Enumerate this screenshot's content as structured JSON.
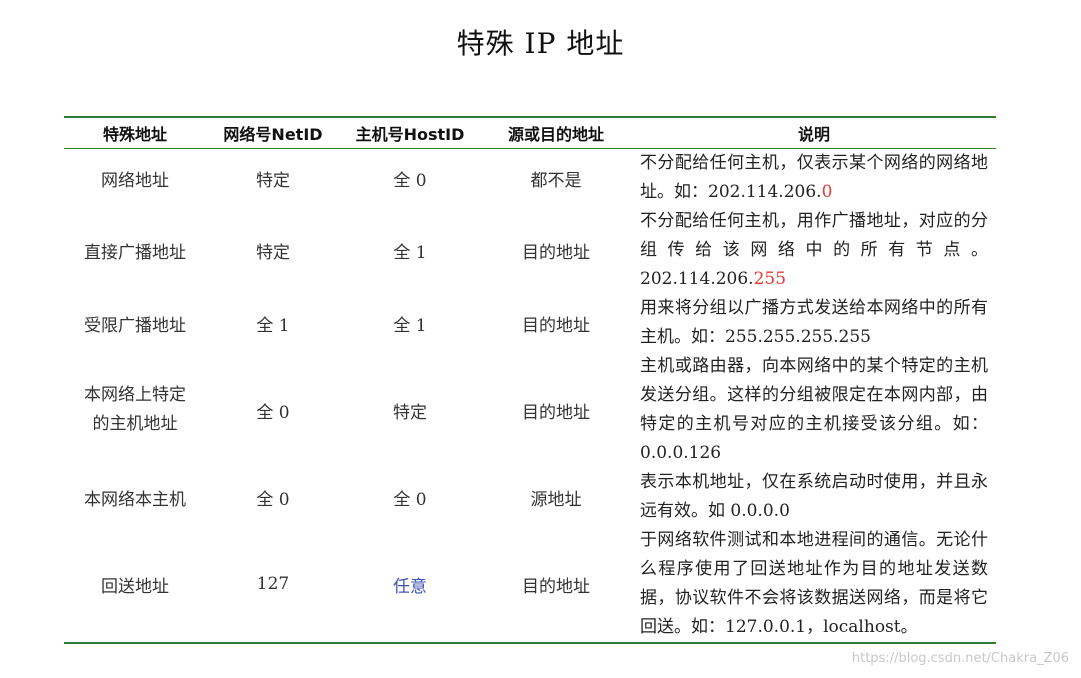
{
  "title": "特殊 IP 地址",
  "headers": [
    "特殊地址",
    "网络号NetID",
    "主机号HostID",
    "源或目的地址",
    "说明"
  ],
  "rows": [
    {
      "name": "网络地址",
      "netid": "特定",
      "hostid": "全 0",
      "srcdst": "都不是",
      "desc_main": "不分配给任何主机，仅表示某个网络的网络地址。如：202.114.206.",
      "desc_highlight": "0",
      "desc_tail": ""
    },
    {
      "name": "直接广播地址",
      "netid": "特定",
      "hostid": "全 1",
      "srcdst": "目的地址",
      "desc_main": "不分配给任何主机，用作广播地址，对应的分组传给该网络中的所有节点。202.114.206.",
      "desc_highlight": "255",
      "desc_tail": ""
    },
    {
      "name": "受限广播地址",
      "netid": "全 1",
      "hostid": "全 1",
      "srcdst": "目的地址",
      "desc_main": "用来将分组以广播方式发送给本网络中的所有主机。如：255.255.255.255",
      "desc_highlight": "",
      "desc_tail": ""
    },
    {
      "name_line1": "本网络上特定",
      "name_line2": "的主机地址",
      "netid": "全 0",
      "hostid": "特定",
      "srcdst": "目的地址",
      "desc_main": "主机或路由器，向本网络中的某个特定的主机发送分组。这样的分组被限定在本网内部，由特定的主机号对应的主机接受该分组。如：0.0.0.126",
      "desc_highlight": "",
      "desc_tail": ""
    },
    {
      "name": "本网络本主机",
      "netid": "全 0",
      "hostid": "全 0",
      "srcdst": "源地址",
      "desc_main": "表示本机地址，仅在系统启动时使用，并且永远有效。如 0.0.0.0",
      "desc_highlight": "",
      "desc_tail": ""
    },
    {
      "name": "回送地址",
      "netid": "127",
      "hostid": "任意",
      "srcdst": "目的地址",
      "desc_main": "于网络软件测试和本地进程间的通信。无论什么程序使用了回送地址作为目的地址发送数据，协议软件不会将该数据送网络，而是将它回送。如：127.0.0.1，localhost。",
      "desc_highlight": "",
      "desc_tail": ""
    }
  ],
  "watermark": "https://blog.csdn.net/Chakra_Z06",
  "colors": {
    "rule": "#2e7d32",
    "highlight_red": "#e53935",
    "highlight_blue": "#3f51b5"
  }
}
